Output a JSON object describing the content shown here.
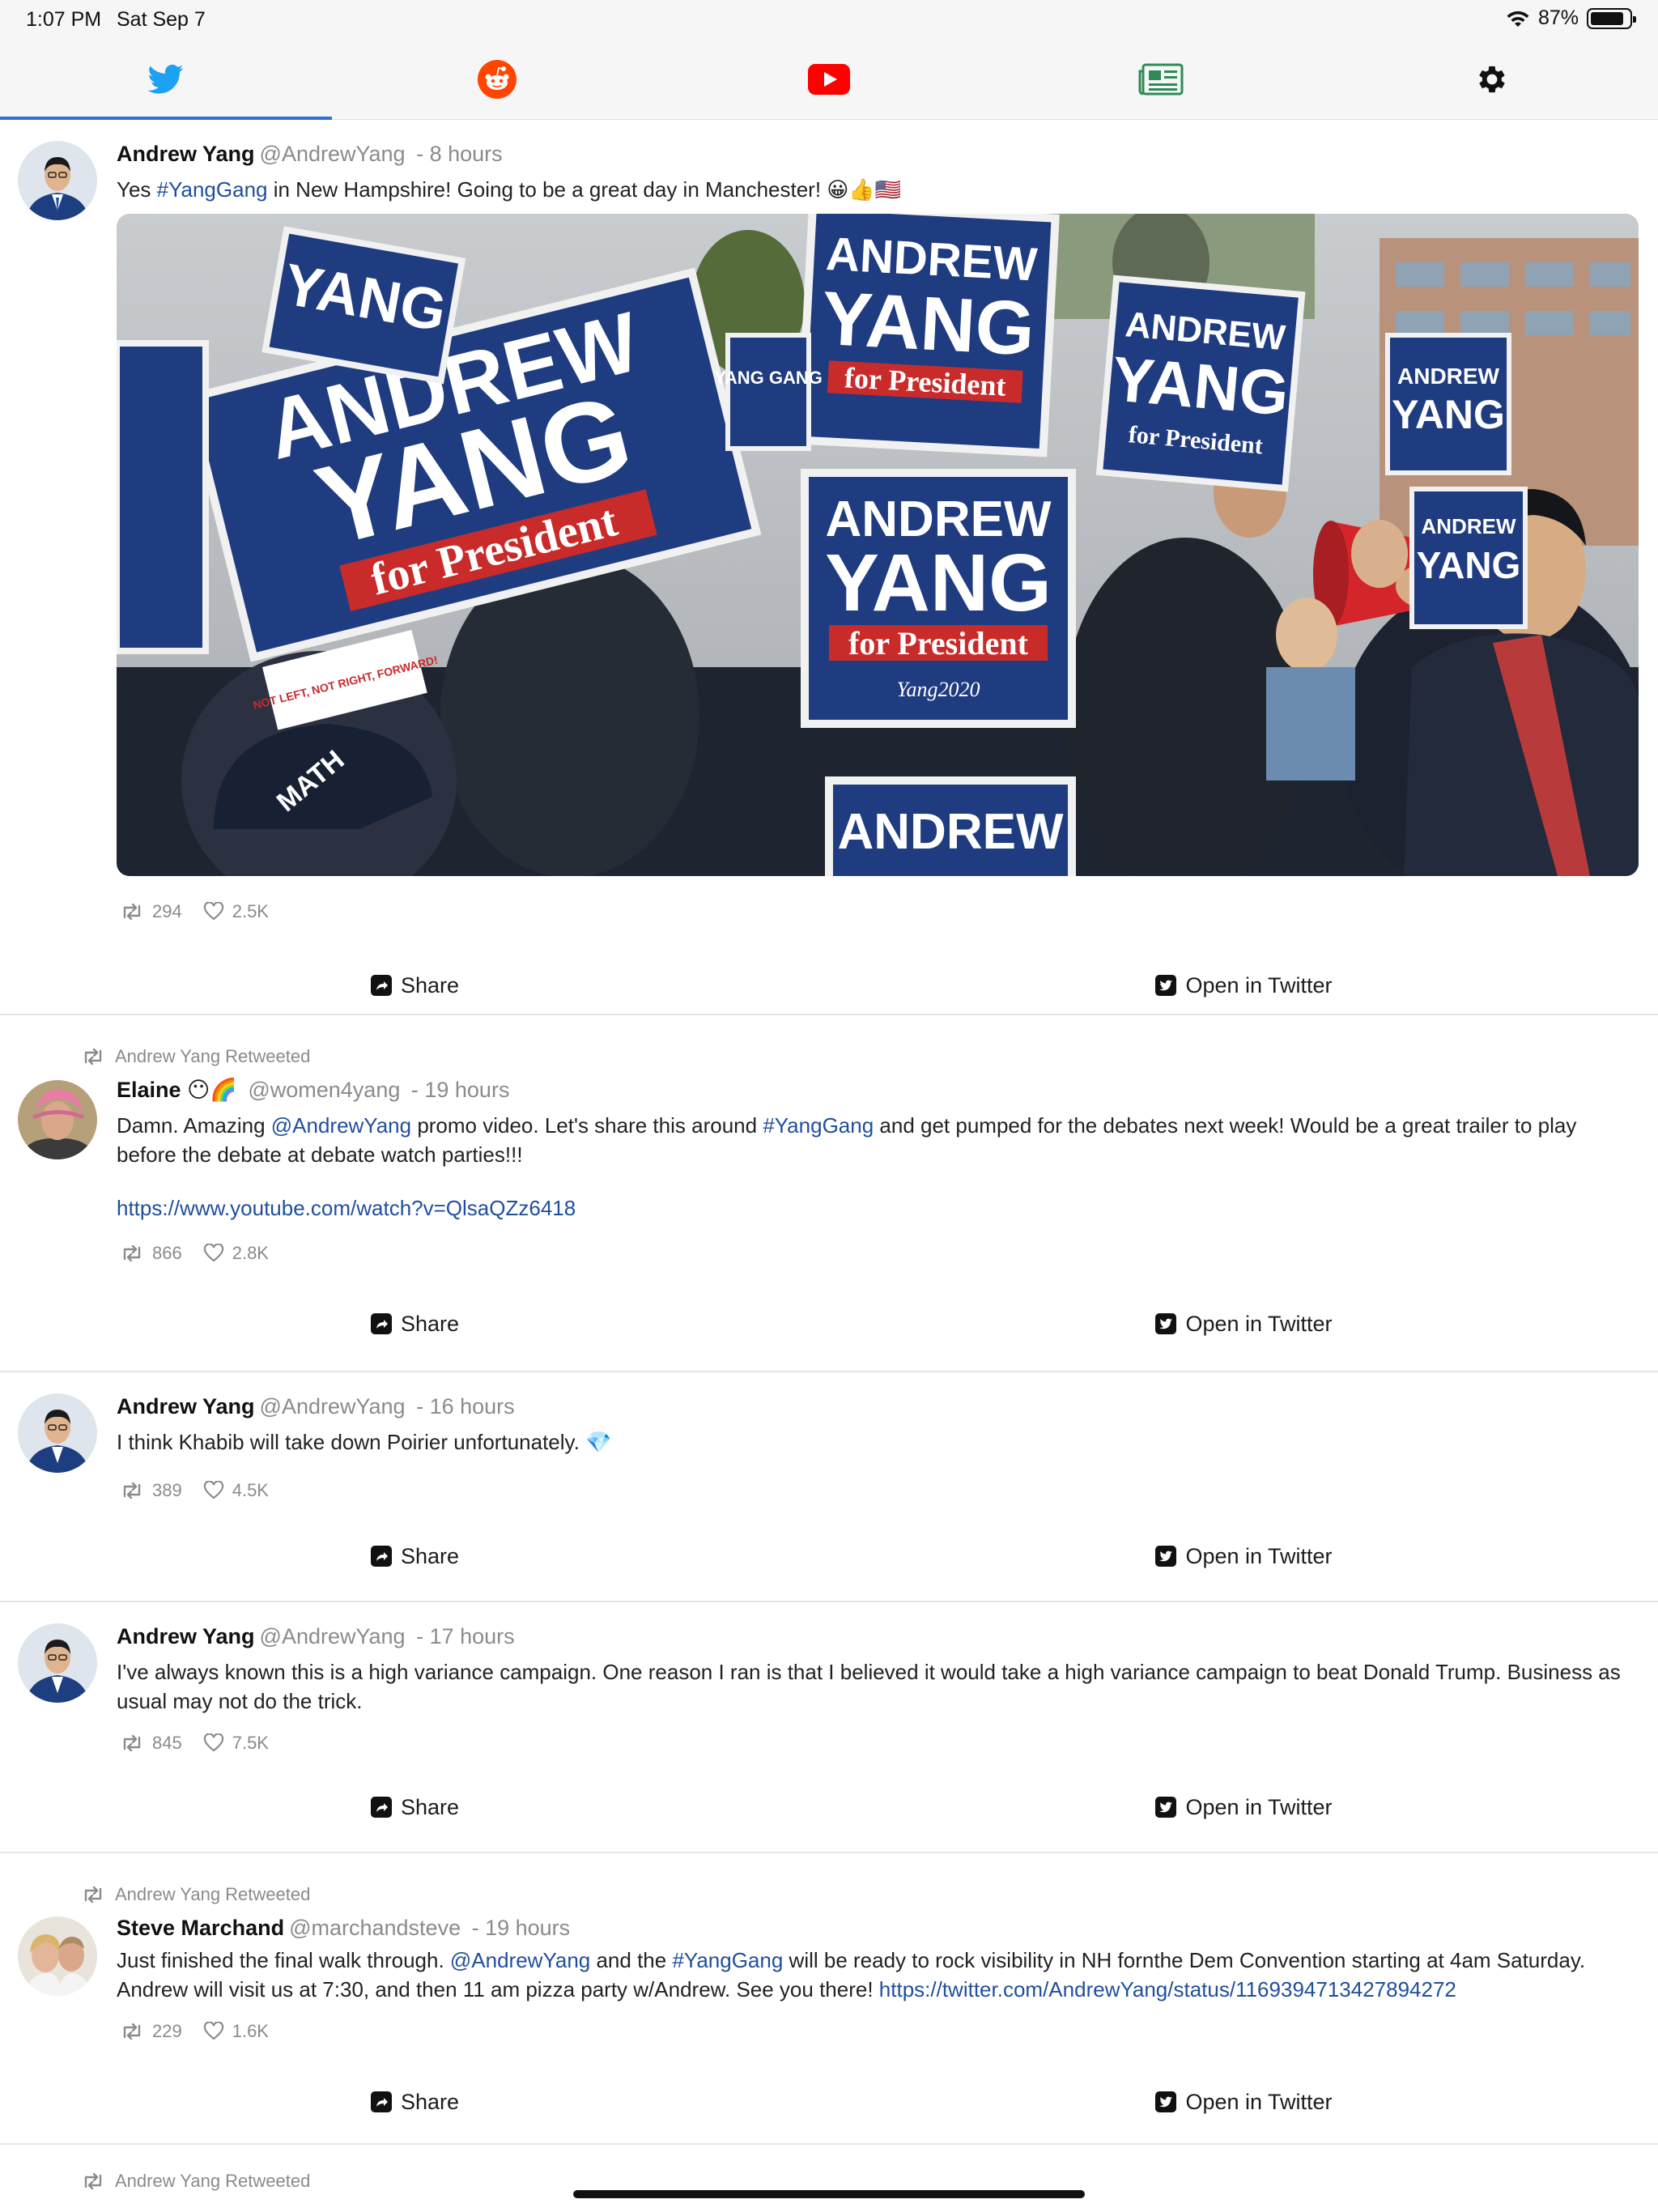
{
  "status": {
    "time": "1:07 PM",
    "date": "Sat Sep 7",
    "battery": "87%",
    "battery_level": 0.87
  },
  "tabs": [
    {
      "icon": "twitter-icon",
      "active": true
    },
    {
      "icon": "reddit-icon",
      "active": false
    },
    {
      "icon": "youtube-icon",
      "active": false
    },
    {
      "icon": "news-icon",
      "active": false
    },
    {
      "icon": "gear-icon",
      "active": false
    }
  ],
  "colors": {
    "accent": "#2f6fdc",
    "link": "#1f4f9c",
    "twitter": "#1da1f2",
    "reddit": "#ff4500",
    "youtube": "#ff0000",
    "news": "#2e8b57"
  },
  "actions": {
    "share": "Share",
    "open": "Open in Twitter"
  },
  "tweets": [
    {
      "name": "Andrew Yang",
      "handle": "@AndrewYang",
      "time": "- 8 hours",
      "text_parts": [
        "Yes ",
        "#YangGang",
        " in New Hampshire!  Going to be a great day in Manchester!  😀👍🇺🇸"
      ],
      "retweets": "294",
      "likes": "2.5K",
      "image_sign_texts": [
        "ANDREW",
        "YANG",
        "for President",
        "Yang2020",
        "NOT LEFT, NOT RIGHT, FORWARD!",
        "YANG GANG",
        "MATH"
      ]
    },
    {
      "retweeted_by": "Andrew Yang Retweeted",
      "name": "Elaine",
      "name_emoji": "😶🌈",
      "handle": "@women4yang",
      "time": "- 19 hours",
      "text_parts": [
        "Damn. Amazing ",
        "@AndrewYang",
        " promo video. Let's share this around ",
        "#YangGang",
        " and get pumped for the debates next week! Would be a great trailer to play before the debate at debate watch parties!!!"
      ],
      "link": "https://www.youtube.com/watch?v=QlsaQZz6418",
      "retweets": "866",
      "likes": "2.8K"
    },
    {
      "name": "Andrew Yang",
      "handle": "@AndrewYang",
      "time": "- 16 hours",
      "text": "I think Khabib will take down Poirier unfortunately.  💎",
      "retweets": "389",
      "likes": "4.5K"
    },
    {
      "name": "Andrew Yang",
      "handle": "@AndrewYang",
      "time": "- 17 hours",
      "text": "I've always known this is a high variance campaign.  One reason I ran is that I believed it would take a high variance campaign to beat Donald Trump.  Business as usual may not do the trick.",
      "retweets": "845",
      "likes": "7.5K"
    },
    {
      "retweeted_by": "Andrew Yang Retweeted",
      "name": "Steve Marchand",
      "handle": "@marchandsteve",
      "time": "- 19 hours",
      "text_parts": [
        "Just finished the final walk through. ",
        "@AndrewYang",
        " and the ",
        "#YangGang",
        " will be ready to rock  visibility in NH fornthe Dem Convention starting at 4am Saturday. Andrew will visit us at 7:30, and then 11 am pizza party w/Andrew. See you there! ",
        "https://twitter.com/AndrewYang/status/1169394713427894272"
      ],
      "retweets": "229",
      "likes": "1.6K"
    }
  ],
  "partial_retweet": "Andrew Yang Retweeted"
}
